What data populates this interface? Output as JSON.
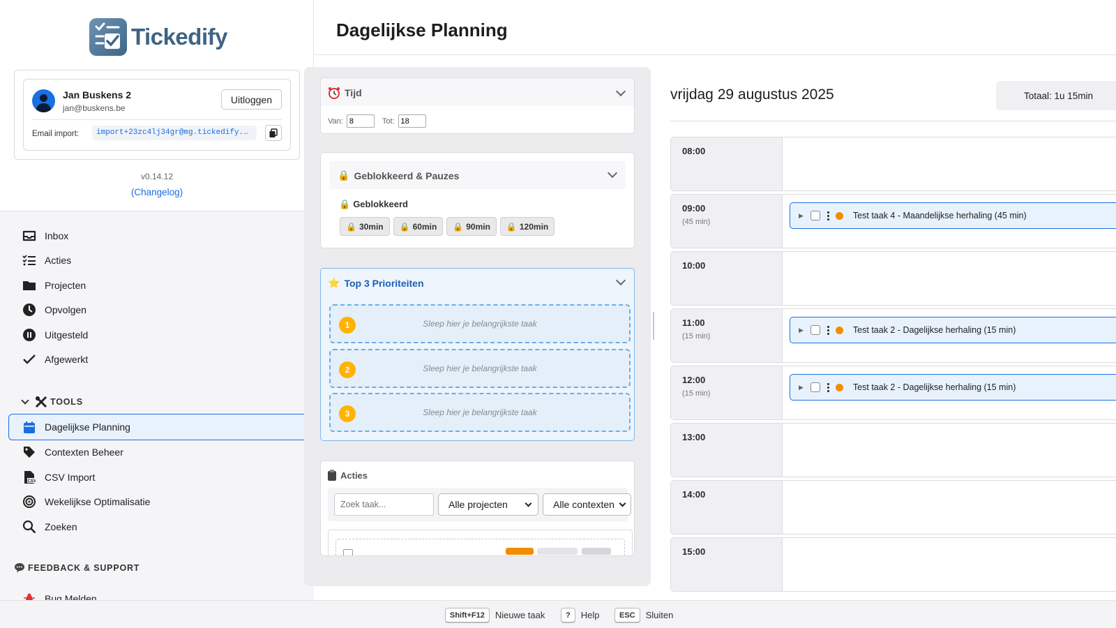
{
  "app": {
    "logo_text": "Tickedify",
    "version": "v0.14.12",
    "changelog": "(Changelog)"
  },
  "user": {
    "name": "Jan Buskens 2",
    "email": "jan@buskens.be",
    "logout_label": "Uitloggen",
    "email_import_label": "Email import:",
    "email_import_value": "import+23zc4lj34gr@mg.tickedify.c…"
  },
  "nav": {
    "items": [
      {
        "label": "Inbox",
        "icon": "inbox-icon"
      },
      {
        "label": "Acties",
        "icon": "list-check-icon"
      },
      {
        "label": "Projecten",
        "icon": "folder-icon"
      },
      {
        "label": "Opvolgen",
        "icon": "clock-icon"
      },
      {
        "label": "Uitgesteld",
        "icon": "pause-icon"
      },
      {
        "label": "Afgewerkt",
        "icon": "check-icon"
      }
    ],
    "tools_heading": "TOOLS",
    "tools": [
      {
        "label": "Dagelijkse Planning",
        "icon": "calendar-icon",
        "active": true
      },
      {
        "label": "Contexten Beheer",
        "icon": "tag-icon"
      },
      {
        "label": "CSV Import",
        "icon": "csv-file-icon"
      },
      {
        "label": "Wekelijkse Optimalisatie",
        "icon": "target-icon"
      },
      {
        "label": "Zoeken",
        "icon": "search-icon"
      }
    ],
    "support_heading": "FEEDBACK & SUPPORT",
    "support": [
      {
        "label": "Bug Melden",
        "icon": "bug-icon"
      }
    ]
  },
  "header": {
    "title": "Dagelijkse Planning"
  },
  "time_card": {
    "title": "Tijd",
    "van_label": "Van:",
    "van_value": "8",
    "tot_label": "Tot:",
    "tot_value": "18"
  },
  "blocked_card": {
    "title": "Geblokkeerd & Pauzes",
    "subtitle": "Geblokkeerd",
    "chips": [
      "30min",
      "60min",
      "90min",
      "120min"
    ]
  },
  "priority_card": {
    "title": "Top 3 Prioriteiten",
    "slots": [
      {
        "num": "1",
        "text": "Sleep hier je belangrijkste taak"
      },
      {
        "num": "2",
        "text": "Sleep hier je belangrijkste taak"
      },
      {
        "num": "3",
        "text": "Sleep hier je belangrijkste taak"
      }
    ]
  },
  "actions_card": {
    "title": "Acties",
    "search_placeholder": "Zoek taak...",
    "project_filter": "Alle projecten",
    "context_filter": "Alle contexten"
  },
  "calendar": {
    "date": "vrijdag 29 augustus 2025",
    "total": "Totaal: 1u 15min",
    "hours": [
      {
        "time": "08:00",
        "duration": "",
        "task": ""
      },
      {
        "time": "09:00",
        "duration": "(45 min)",
        "task": "Test taak 4 - Maandelijkse herhaling (45 min)"
      },
      {
        "time": "10:00",
        "duration": "",
        "task": ""
      },
      {
        "time": "11:00",
        "duration": "(15 min)",
        "task": "Test taak 2 - Dagelijkse herhaling (15 min)"
      },
      {
        "time": "12:00",
        "duration": "(15 min)",
        "task": "Test taak 2 - Dagelijkse herhaling (15 min)"
      },
      {
        "time": "13:00",
        "duration": "",
        "task": ""
      },
      {
        "time": "14:00",
        "duration": "",
        "task": ""
      },
      {
        "time": "15:00",
        "duration": "",
        "task": ""
      }
    ]
  },
  "footer": {
    "shortcuts": [
      {
        "key": "Shift+F12",
        "label": "Nieuwe taak"
      },
      {
        "key": "?",
        "label": "Help"
      },
      {
        "key": "ESC",
        "label": "Sluiten"
      }
    ]
  },
  "colors": {
    "accent": "#1a6fe0",
    "task_dot": "#f28c00",
    "priority_badge": "#ffb300"
  }
}
